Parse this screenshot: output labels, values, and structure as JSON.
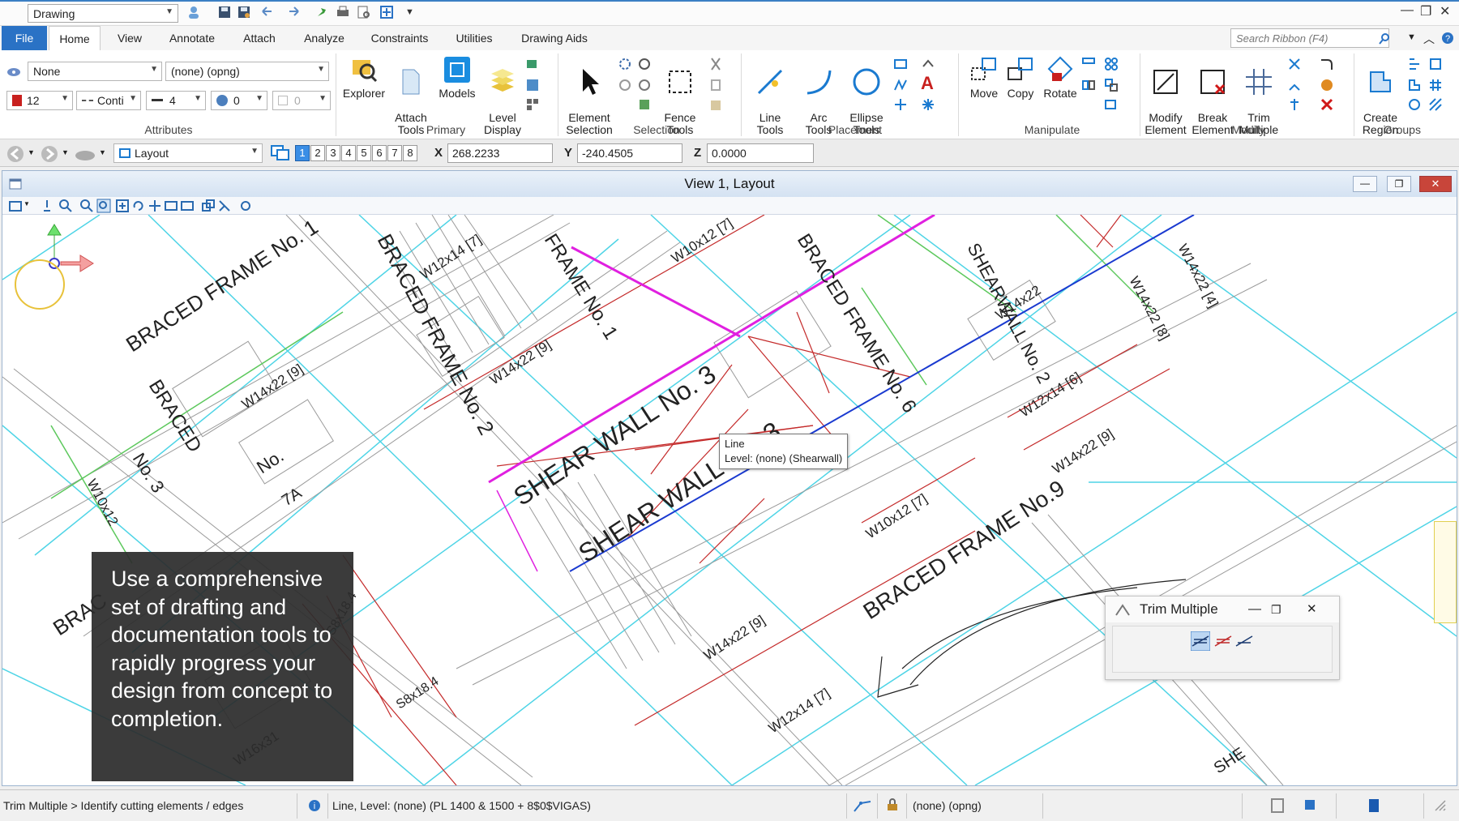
{
  "app": {
    "workflow": "Drawing"
  },
  "tabs": [
    "File",
    "Home",
    "View",
    "Annotate",
    "Attach",
    "Analyze",
    "Constraints",
    "Utilities",
    "Drawing Aids"
  ],
  "search": {
    "placeholder": "Search Ribbon (F4)"
  },
  "attributes": {
    "level": "None",
    "text_style": "(none) (opng)",
    "color": "12",
    "line_style": "Conti",
    "weight": "4",
    "transparency": "0",
    "priority": "0",
    "label": "Attributes"
  },
  "primary": {
    "label": "Primary",
    "buttons": [
      "Explorer",
      "Attach\nTools",
      "Models",
      "Level\nDisplay"
    ]
  },
  "selection": {
    "label": "Selection",
    "buttons": [
      "Element\nSelection",
      "Fence\nTools"
    ]
  },
  "placement": {
    "label": "Placement",
    "buttons": [
      "Line\nTools",
      "Arc\nTools",
      "Ellipse\nTools"
    ]
  },
  "manipulate": {
    "label": "Manipulate",
    "buttons": [
      "Move",
      "Copy",
      "Rotate"
    ]
  },
  "modify": {
    "label": "Modify",
    "buttons": [
      "Modify\nElement",
      "Break\nElement",
      "Trim\nMultiple"
    ]
  },
  "groups": {
    "label": "Groups",
    "buttons": [
      "Create\nRegion"
    ]
  },
  "coords": {
    "view_model": "Layout",
    "views": [
      "1",
      "2",
      "3",
      "4",
      "5",
      "6",
      "7",
      "8"
    ],
    "x_label": "X",
    "x": "268.2233",
    "y_label": "Y",
    "y": "-240.4505",
    "z_label": "Z",
    "z": "0.0000"
  },
  "view": {
    "title": "View 1, Layout"
  },
  "tooltip": {
    "line1": "Line",
    "line2": "Level: (none) (Shearwall)"
  },
  "promo": {
    "text": "Use a comprehensive set of drafting and documentation tools to rapidly progress your design from concept to completion."
  },
  "trim_dialog": {
    "title": "Trim Multiple"
  },
  "drawing_labels": [
    "BRACED FRAME No. 1",
    "BRACED FRAME No. 2",
    "FRAME No. 1",
    "BRACED FRAME No. 6",
    "SHEAR WALL No. 3",
    "SHEAR WALL No. 3",
    "SHEARWALL No. 2",
    "BRACED FRAME No.9",
    "BRACED",
    "No. 3",
    "BRAC",
    "7A",
    "W12x14 [7]",
    "W10x12 [7]",
    "W14x22 [9]",
    "W14x22 [9]",
    "W14x22 [4]",
    "W14x22 [8]",
    "W12x14 [6]",
    "W14x22 [9]",
    "W10x12 [7]",
    "W14x22 [9]",
    "W12x14 [7]",
    "W16x31",
    "S8x18.4",
    "S8x18.4",
    "W10x12",
    "No.",
    "SHE",
    "W14x22"
  ],
  "status": {
    "prompt": "Trim Multiple > Identify cutting elements / edges",
    "message": "Line, Level: (none) (PL 1400 & 1500 + 8$0$VIGAS)",
    "level": "(none) (opng)"
  },
  "colors": {
    "accent": "#2a72c5",
    "cyan_grid": "#4fd6e6",
    "magenta": "#e020e0",
    "red": "#c02020",
    "blue": "#1a3ad0",
    "green": "#5cc85c"
  }
}
